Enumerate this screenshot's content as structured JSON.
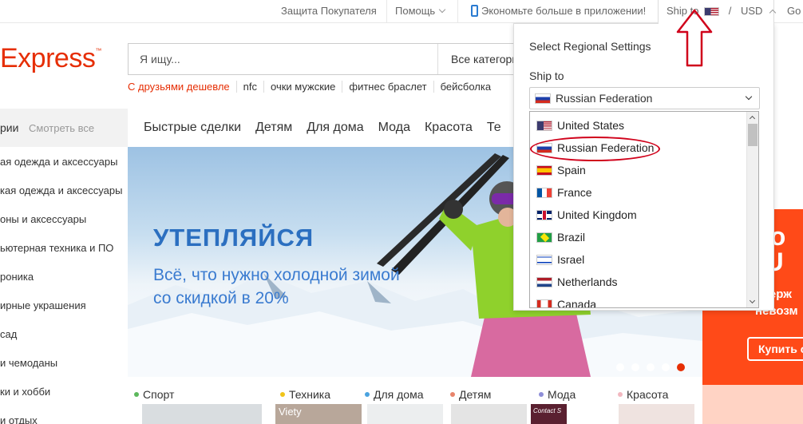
{
  "topbar": {
    "buyer_protection": "Защита Покупателя",
    "help": "Помощь",
    "app_promo": "Экономьте больше в приложении!",
    "ship_to": "Ship to",
    "separator": "/",
    "currency": "USD",
    "language": "Go"
  },
  "header": {
    "logo": "Express",
    "logo_mark": "™",
    "search_placeholder": "Я ищу...",
    "search_category": "Все категории"
  },
  "hotwords": [
    "С друзьями дешевле",
    "nfc",
    "очки мужские",
    "фитнес браслет",
    "бейсболка"
  ],
  "catbar": {
    "categories_label": "рии",
    "see_all": "Смотреть все",
    "nav": [
      "Быстрые сделки",
      "Детям",
      "Для дома",
      "Мода",
      "Красота",
      "Те"
    ]
  },
  "left_categories": [
    "ая одежда и аксессуары",
    "кая одежда и аксессуары",
    "оны и аксессуары",
    "ьютерная техника и ПО",
    "роника",
    "ирные украшения",
    "сад",
    "и чемоданы",
    "ки и хобби",
    "и отдых"
  ],
  "banner": {
    "title": "УТЕПЛЯЙСЯ",
    "subtitle": "Всё, что нужно холодной зимой со скидкой в 20%",
    "dot_count": 5,
    "active_dot": 4
  },
  "promo": {
    "line1": "ахо",
    "line2": "о U",
    "small1": "Удерж",
    "small2": "невозм",
    "button": "Купить с"
  },
  "bottom_tabs": [
    {
      "label": "Спорт",
      "color": "#5cb85c"
    },
    {
      "label": "Техника",
      "color": "#f0c419"
    },
    {
      "label": "Для дома",
      "color": "#4aa3df"
    },
    {
      "label": "Детям",
      "color": "#e8846b"
    },
    {
      "label": "Мода",
      "color": "#8e8ed8"
    },
    {
      "label": "Красота",
      "color": "#f2b8c0"
    }
  ],
  "bottom_thumbs": [
    "",
    "Viety",
    "",
    "",
    "Contact S",
    ""
  ],
  "region_panel": {
    "title": "Select Regional Settings",
    "ship_to_label": "Ship to",
    "selected": "Russian Federation",
    "options": [
      {
        "label": "United States",
        "flag": "us"
      },
      {
        "label": "Russian Federation",
        "flag": "ru"
      },
      {
        "label": "Spain",
        "flag": "es"
      },
      {
        "label": "France",
        "flag": "fr"
      },
      {
        "label": "United Kingdom",
        "flag": "gb"
      },
      {
        "label": "Brazil",
        "flag": "br"
      },
      {
        "label": "Israel",
        "flag": "il"
      },
      {
        "label": "Netherlands",
        "flag": "nl"
      },
      {
        "label": "Canada",
        "flag": "ca"
      }
    ]
  },
  "colors": {
    "brand": "#e62e04",
    "link_blue": "#2b6fc0",
    "annotation_red": "#d0021b"
  }
}
